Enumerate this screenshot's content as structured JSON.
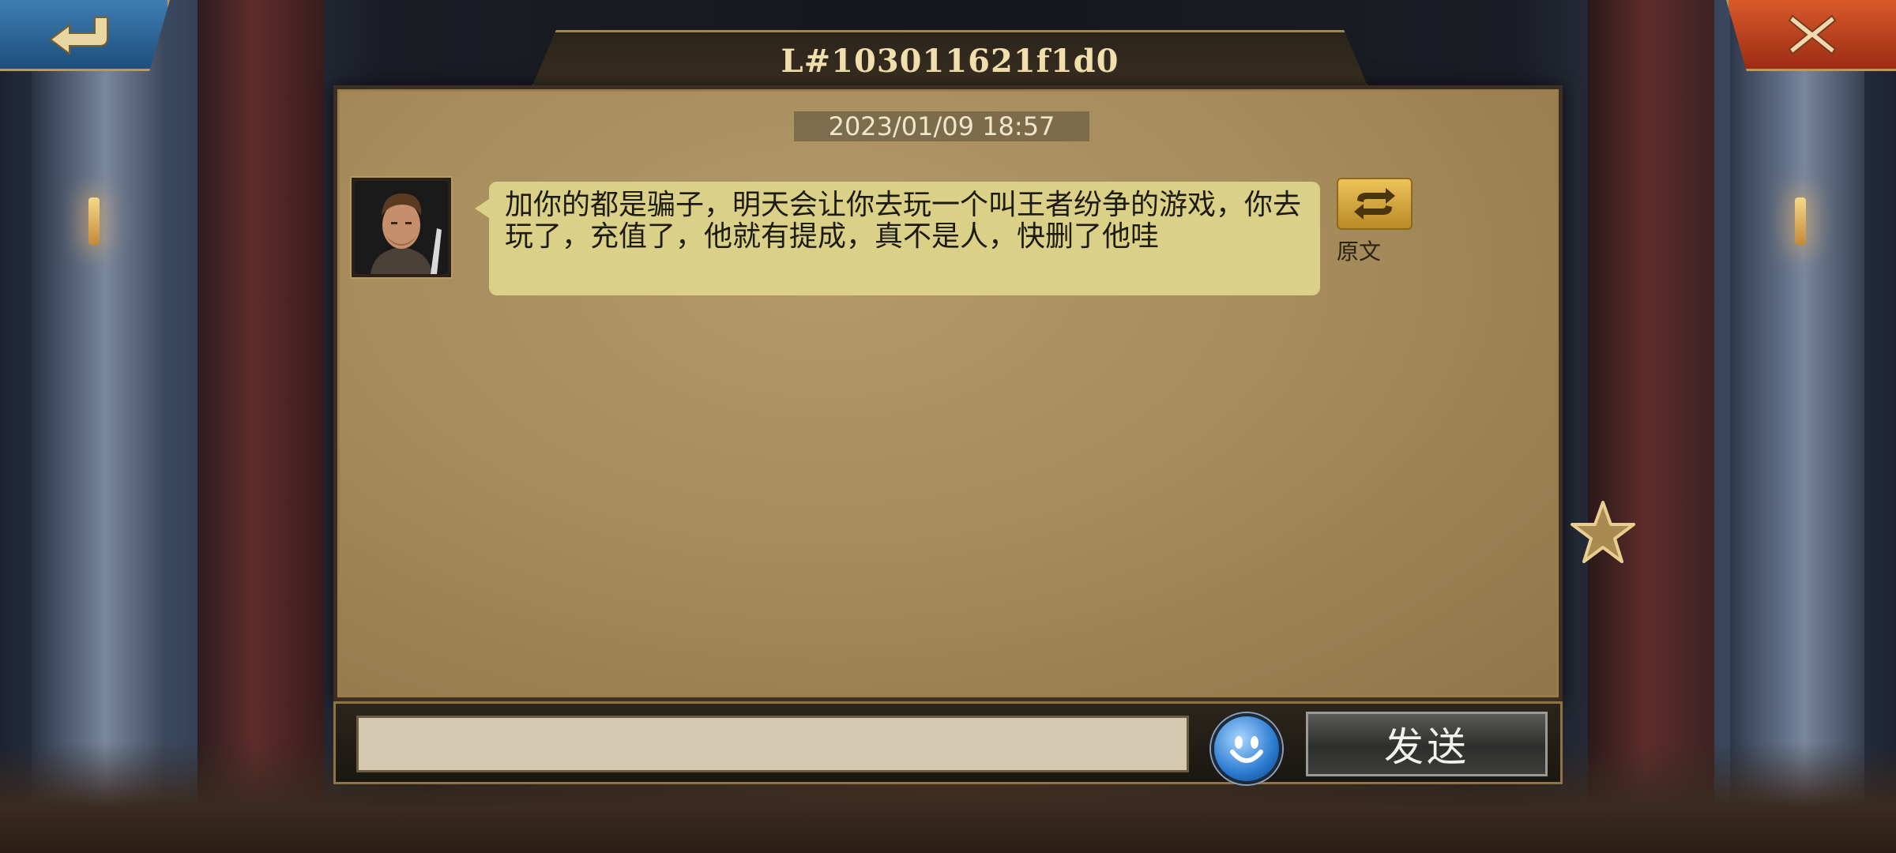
{
  "header": {
    "title": "L#103011621f1d0"
  },
  "nav": {
    "back_icon": "back-arrow-icon",
    "close_icon": "close-x-icon"
  },
  "conversation": {
    "timestamp": "2023/01/09 18:57",
    "messages": [
      {
        "avatar": "player-avatar",
        "text": "加你的都是骗子，明天会让你去玩一个叫王者纷争的游戏，你去玩了，充值了，他就有提成，真不是人，快删了他哇",
        "translate_label": "原文",
        "translate_icon": "swap-arrows-icon"
      }
    ]
  },
  "composer": {
    "input_value": "",
    "emoji_icon": "smiley-icon",
    "send_label": "发送"
  },
  "side": {
    "favorite_icon": "star-icon"
  },
  "colors": {
    "parchment": "#a78c5c",
    "bubble": "#dbd087",
    "title_text": "#f1dfae",
    "back_button": "#2f6a9e",
    "close_button": "#c0441f"
  }
}
